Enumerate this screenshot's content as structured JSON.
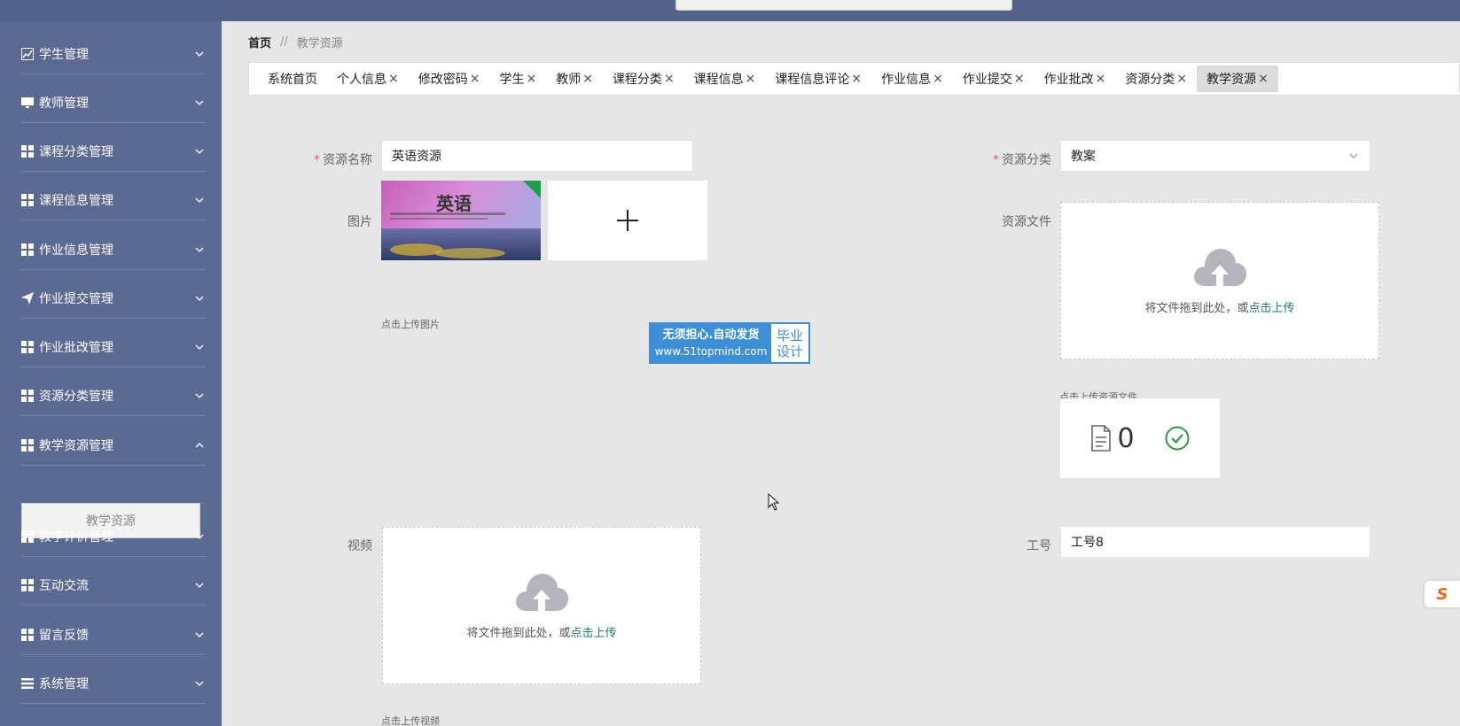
{
  "sidebar": {
    "items": [
      {
        "label": "学生管理",
        "icon": "trend-chart-icon",
        "expanded": false
      },
      {
        "label": "教师管理",
        "icon": "monitor-icon",
        "expanded": false
      },
      {
        "label": "课程分类管理",
        "icon": "grid-icon",
        "expanded": false
      },
      {
        "label": "课程信息管理",
        "icon": "grid-icon",
        "expanded": false
      },
      {
        "label": "作业信息管理",
        "icon": "grid-icon",
        "expanded": false
      },
      {
        "label": "作业提交管理",
        "icon": "send-icon",
        "expanded": false
      },
      {
        "label": "作业批改管理",
        "icon": "grid-icon",
        "expanded": false
      },
      {
        "label": "资源分类管理",
        "icon": "grid-icon",
        "expanded": false
      },
      {
        "label": "教学资源管理",
        "icon": "grid-icon",
        "expanded": true
      },
      {
        "label": "教学评价管理",
        "icon": "grid-icon",
        "expanded": false
      },
      {
        "label": "互动交流",
        "icon": "grid-icon",
        "expanded": false
      },
      {
        "label": "留言反馈",
        "icon": "grid-icon",
        "expanded": false
      },
      {
        "label": "系统管理",
        "icon": "list-icon",
        "expanded": false
      }
    ],
    "submenu_active": "教学资源"
  },
  "breadcrumb": {
    "home": "首页",
    "separator": "//",
    "current": "教学资源"
  },
  "tabs": [
    {
      "label": "系统首页",
      "close": ""
    },
    {
      "label": "个人信息",
      "close": "×"
    },
    {
      "label": "修改密码",
      "close": "×"
    },
    {
      "label": "学生",
      "close": "×"
    },
    {
      "label": "教师",
      "close": "×"
    },
    {
      "label": "课程分类",
      "close": "×"
    },
    {
      "label": "课程信息",
      "close": "×"
    },
    {
      "label": "课程信息评论",
      "close": "×"
    },
    {
      "label": "作业信息",
      "close": "×"
    },
    {
      "label": "作业提交",
      "close": "×"
    },
    {
      "label": "作业批改",
      "close": "×"
    },
    {
      "label": "资源分类",
      "close": "×"
    },
    {
      "label": "教学资源",
      "close": "×",
      "active": true
    }
  ],
  "form": {
    "required_mark": "*",
    "resource_name": {
      "label": "资源名称",
      "value": "英语资源"
    },
    "resource_category": {
      "label": "资源分类",
      "value": "教案"
    },
    "image": {
      "label": "图片",
      "hint": "点击上传图片",
      "thumb_text": "英语"
    },
    "resource_file": {
      "label": "资源文件",
      "drop_text": "将文件拖到此处，或",
      "drop_link": "点击上传",
      "hint": "点击上传资源文件",
      "file_count": "0"
    },
    "video": {
      "label": "视频",
      "drop_text": "将文件拖到此处，或",
      "drop_link": "点击上传",
      "hint": "点击上传视频"
    },
    "staff_id": {
      "label": "工号",
      "value": "工号8"
    }
  },
  "watermark": {
    "line1": "无须担心.自动发货",
    "line2": "www.51topmind.com",
    "right1": "毕业",
    "right2": "设计"
  },
  "side_badge": "S",
  "colors": {
    "sidebar_bg": "#5a6a93",
    "topbar_bg": "#53628a",
    "link": "#1e7a6e",
    "success": "#2e9a3c",
    "required": "#e55555"
  }
}
